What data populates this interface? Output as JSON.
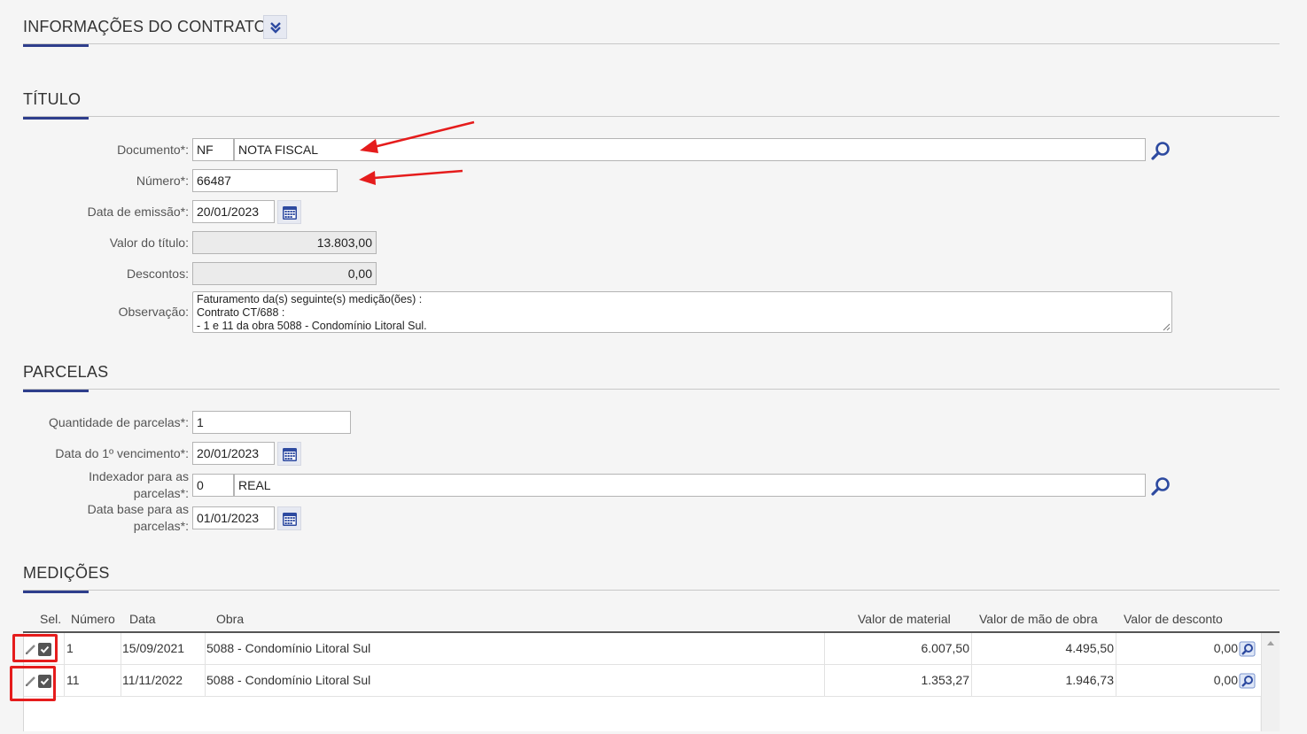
{
  "header": {
    "title": "INFORMAÇÕES DO CONTRATO",
    "toggle_icon": "double-chevron-down-icon"
  },
  "titulo": {
    "section": "TÍTULO",
    "documento": {
      "label": "Documento*:",
      "code": "NF",
      "name": "NOTA FISCAL"
    },
    "numero": {
      "label": "Número*:",
      "value": "66487"
    },
    "data_emissao": {
      "label": "Data de emissão*:",
      "value": "20/01/2023"
    },
    "valor_titulo": {
      "label": "Valor do título:",
      "value": "13.803,00"
    },
    "descontos": {
      "label": "Descontos:",
      "value": "0,00"
    },
    "observacao": {
      "label": "Observação:",
      "lines": [
        "Faturamento da(s) seguinte(s) medição(ões) :",
        "Contrato CT/688 :",
        "- 1 e 11 da obra 5088 - Condomínio Litoral Sul."
      ]
    }
  },
  "parcelas": {
    "section": "PARCELAS",
    "quantidade": {
      "label": "Quantidade de parcelas*:",
      "value": "1"
    },
    "primeiro_vencimento": {
      "label": "Data do 1º vencimento*:",
      "value": "20/01/2023"
    },
    "indexador": {
      "label_line1": "Indexador para as",
      "label_line2": "parcelas*:",
      "code": "0",
      "name": "REAL"
    },
    "data_base": {
      "label_line1": "Data base para as",
      "label_line2": "parcelas*:",
      "value": "01/01/2023"
    }
  },
  "medicoes": {
    "section": "MEDIÇÕES",
    "columns": [
      "Sel.",
      "Número",
      "Data",
      "Obra",
      "Valor de material",
      "Valor de mão de obra",
      "Valor de desconto"
    ],
    "rows": [
      {
        "numero": "1",
        "data": "15/09/2021",
        "obra": "5088 - Condomínio Litoral Sul",
        "material": "6.007,50",
        "mao_obra": "4.495,50",
        "desconto": "0,00",
        "selected": true
      },
      {
        "numero": "11",
        "data": "11/11/2022",
        "obra": "5088 - Condomínio Litoral Sul",
        "material": "1.353,27",
        "mao_obra": "1.946,73",
        "desconto": "0,00",
        "selected": true
      }
    ]
  },
  "colors": {
    "accent": "#2e3e8c",
    "annotation": "#e51c1c",
    "icon": "#2d4aa0"
  }
}
